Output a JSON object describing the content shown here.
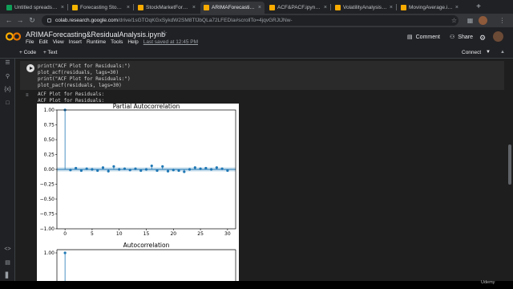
{
  "browser": {
    "tabs": [
      {
        "title": "Untitled spreadsheet",
        "fav_color": "#0f9d58",
        "active": false
      },
      {
        "title": "Forecasting Stock Pric",
        "fav_color": "#f4b400",
        "active": false
      },
      {
        "title": "StockMarketForecasti",
        "fav_color": "#f9ab00",
        "active": false
      },
      {
        "title": "ARIMAForecasting&R",
        "fav_color": "#f9ab00",
        "active": true
      },
      {
        "title": "ACF&PACF.ipynb - Co",
        "fav_color": "#f9ab00",
        "active": false
      },
      {
        "title": "VolatilityAnalysis.ipyn",
        "fav_color": "#f9ab00",
        "active": false
      },
      {
        "title": "MovingAverage.ipynb",
        "fav_color": "#f9ab00",
        "active": false
      }
    ],
    "new_tab": "+",
    "url_host": "colab.research.google.com",
    "url_path": "/drive/1sGTOqKGxSykdW2SM8TfJbQLa72LFEDIa#scrollTo=4jqvGRJtJNw-"
  },
  "colab": {
    "title": "ARIMAForecasting&ResidualAnalysis.ipynb",
    "menu": [
      "File",
      "Edit",
      "View",
      "Insert",
      "Runtime",
      "Tools",
      "Help"
    ],
    "saved_text": "Last saved at 12:45 PM",
    "comment_label": "Comment",
    "share_label": "Share",
    "add_code_label": "+ Code",
    "add_text_label": "+ Text",
    "connect_label": "Connect"
  },
  "cell": {
    "code_lines": [
      "print(\"ACF Plot for Residuals:\")",
      "plot_acf(residuals, lags=30)",
      "print(\"ACF Plot for Residuals:\")",
      "plot_pacf(residuals, lags=30)"
    ],
    "output_lines": [
      "ACF Plot for Residuals:",
      "ACF Plot for Residuals:"
    ]
  },
  "chart_data": [
    {
      "type": "scatter",
      "title": "Partial Autocorrelation",
      "xlabel": "",
      "ylabel": "",
      "xlim": [
        -1.5,
        31.5
      ],
      "ylim": [
        -1.0,
        1.0
      ],
      "x_ticks": [
        0,
        5,
        10,
        15,
        20,
        25,
        30
      ],
      "y_ticks": [
        "1.00",
        "0.75",
        "0.50",
        "0.25",
        "0.00",
        "−0.25",
        "−0.50",
        "−0.75",
        "−1.00"
      ],
      "y_tick_values": [
        1.0,
        0.75,
        0.5,
        0.25,
        0.0,
        -0.25,
        -0.5,
        -0.75,
        -1.0
      ],
      "confidence_band": 0.035,
      "series": [
        {
          "x": [
            0,
            1,
            2,
            3,
            4,
            5,
            6,
            7,
            8,
            9,
            10,
            11,
            12,
            13,
            14,
            15,
            16,
            17,
            18,
            19,
            20,
            21,
            22,
            23,
            24,
            25,
            26,
            27,
            28,
            29,
            30
          ],
          "values": [
            1.0,
            -0.01,
            0.02,
            -0.02,
            0.01,
            0.0,
            -0.02,
            0.03,
            -0.03,
            0.05,
            0.0,
            0.01,
            -0.01,
            0.01,
            -0.02,
            0.0,
            0.06,
            -0.02,
            0.05,
            -0.03,
            -0.01,
            -0.02,
            -0.04,
            0.0,
            0.03,
            0.01,
            0.02,
            0.0,
            0.03,
            0.01,
            -0.02
          ]
        }
      ],
      "colors": {
        "stem": "#1f77b4",
        "band": "#a6c8e0"
      }
    },
    {
      "type": "scatter",
      "title": "Autocorrelation",
      "y_ticks": [
        "1.00"
      ],
      "series": [
        {
          "x": [
            0
          ],
          "values": [
            1.0
          ]
        }
      ]
    }
  ],
  "overlay": {
    "brand": "Udemy"
  }
}
